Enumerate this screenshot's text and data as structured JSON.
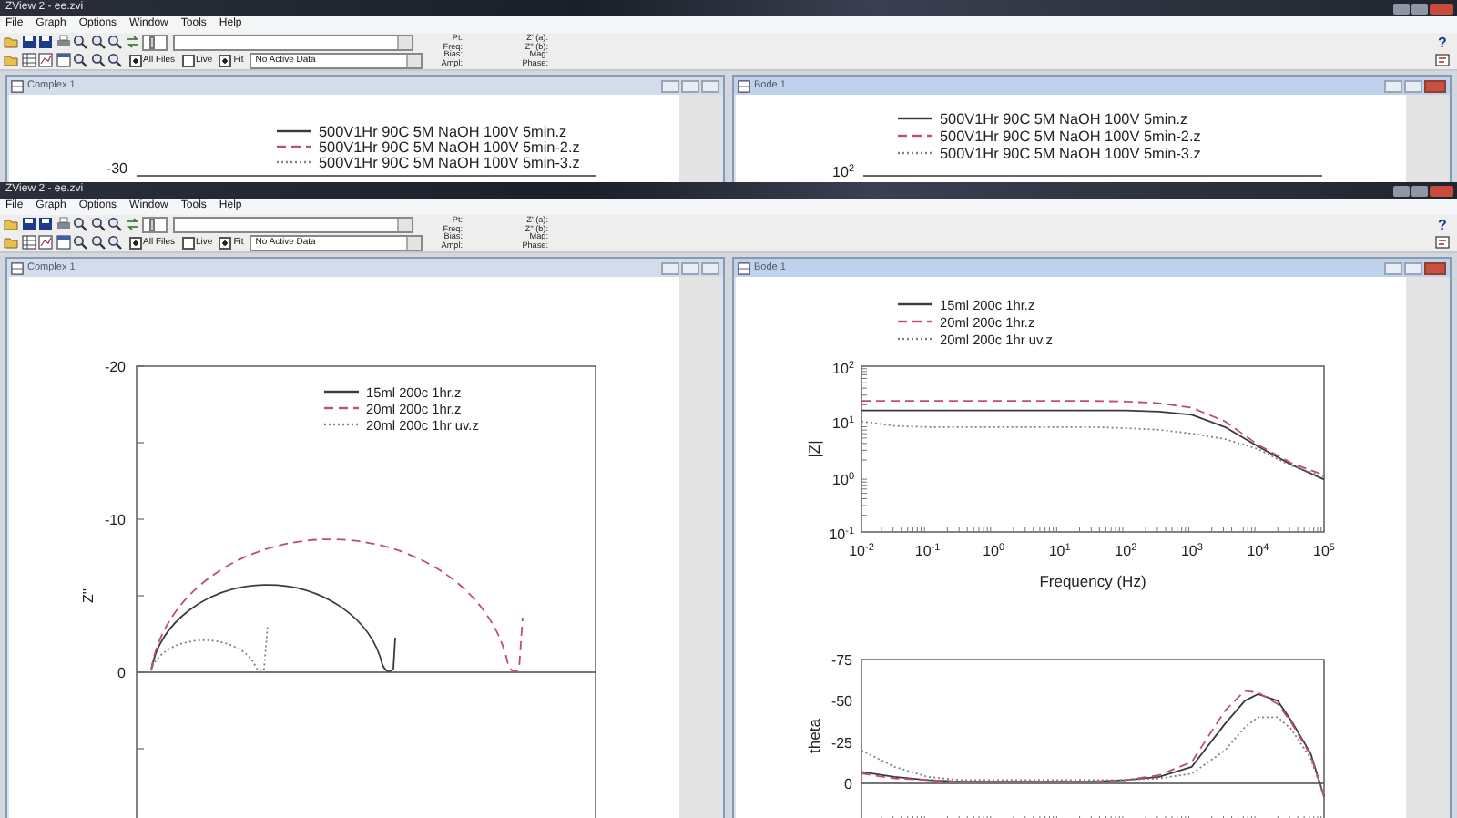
{
  "windows": [
    {
      "title": "ZView 2 - ee.zvi",
      "menu": [
        "File",
        "Graph",
        "Options",
        "Window",
        "Tools",
        "Help"
      ],
      "toolbar": {
        "slider": {
          "level": 0.3
        },
        "options": [
          {
            "label": "All Files",
            "checked": true
          },
          {
            "label": "Live",
            "checked": false
          },
          {
            "label": "Fit",
            "checked": true
          }
        ],
        "data_dropdown": "No Active Data",
        "point_labels": [
          "Pt:",
          "Freq:",
          "Bias:",
          "Ampl:"
        ],
        "value_labels": [
          "Z' (a):",
          "Z'' (b):",
          "Mag:",
          "Phase:"
        ],
        "help": "?"
      },
      "panes": [
        {
          "title": "Complex 1",
          "active": false,
          "kind": "clipped",
          "top_tick": "-30",
          "legend": [
            {
              "label": "500V1Hr 90C 5M NaOH 100V 5min.z",
              "color": "#3a3a3a"
            },
            {
              "label": "500V1Hr 90C 5M NaOH 100V 5min-2.z",
              "color": "#c0506a"
            },
            {
              "label": "500V1Hr 90C 5M NaOH 100V 5min-3.z",
              "color": "#808080"
            }
          ]
        },
        {
          "title": "Bode 1",
          "active": true,
          "kind": "clipped",
          "top_tick": "10$^{2}$",
          "legend": [
            {
              "label": "500V1Hr 90C 5M NaOH 100V 5min.z",
              "color": "#3a3a3a"
            },
            {
              "label": "500V1Hr 90C 5M NaOH 100V 5min-2.z",
              "color": "#c0506a"
            },
            {
              "label": "500V1Hr 90C 5M NaOH 100V 5min-3.z",
              "color": "#808080"
            }
          ]
        }
      ]
    },
    {
      "title": "ZView 2 - ee.zvi",
      "menu": [
        "File",
        "Graph",
        "Options",
        "Window",
        "Tools",
        "Help"
      ],
      "toolbar": {
        "slider": {
          "level": 0.3
        },
        "options": [
          {
            "label": "All Files",
            "checked": true
          },
          {
            "label": "Live",
            "checked": false
          },
          {
            "label": "Fit",
            "checked": true
          }
        ],
        "data_dropdown": "No Active Data",
        "point_labels": [
          "Pt:",
          "Freq:",
          "Bias:",
          "Ampl:"
        ],
        "value_labels": [
          "Z' (a):",
          "Z'' (b):",
          "Mag:",
          "Phase:"
        ],
        "help": "?"
      },
      "panes": [
        {
          "title": "Complex 1",
          "active": false,
          "kind": "complex",
          "ylabel": "Z''",
          "y_ticks": [
            "-20",
            "-10",
            "0"
          ],
          "legend": [
            {
              "label": "15ml 200c 1hr.z",
              "color": "#3a3a3a"
            },
            {
              "label": "20ml 200c 1hr.z",
              "color": "#c0506a"
            },
            {
              "label": "20ml 200c 1hr uv.z",
              "color": "#808080"
            }
          ]
        },
        {
          "title": "Bode 1",
          "active": true,
          "kind": "bode",
          "legend": [
            {
              "label": "15ml 200c 1hr.z",
              "color": "#3a3a3a"
            },
            {
              "label": "20ml 200c 1hr.z",
              "color": "#c0506a"
            },
            {
              "label": "20ml 200c 1hr uv.z",
              "color": "#808080"
            }
          ],
          "magnitude": {
            "xlabel": "Frequency (Hz)",
            "ylabel": "|Z|",
            "x_ticks": [
              "10$^{-2}$",
              "10$^{-1}$",
              "10$^{0}$",
              "10$^{1}$",
              "10$^{2}$",
              "10$^{3}$",
              "10$^{4}$",
              "10$^{5}$"
            ],
            "y_ticks": [
              "10$^{2}$",
              "10$^{1}$",
              "10$^{0}$",
              "10$^{-1}$"
            ]
          },
          "phase": {
            "ylabel": "theta",
            "y_ticks": [
              "-75",
              "-50",
              "-25",
              "0"
            ]
          }
        }
      ]
    }
  ]
}
